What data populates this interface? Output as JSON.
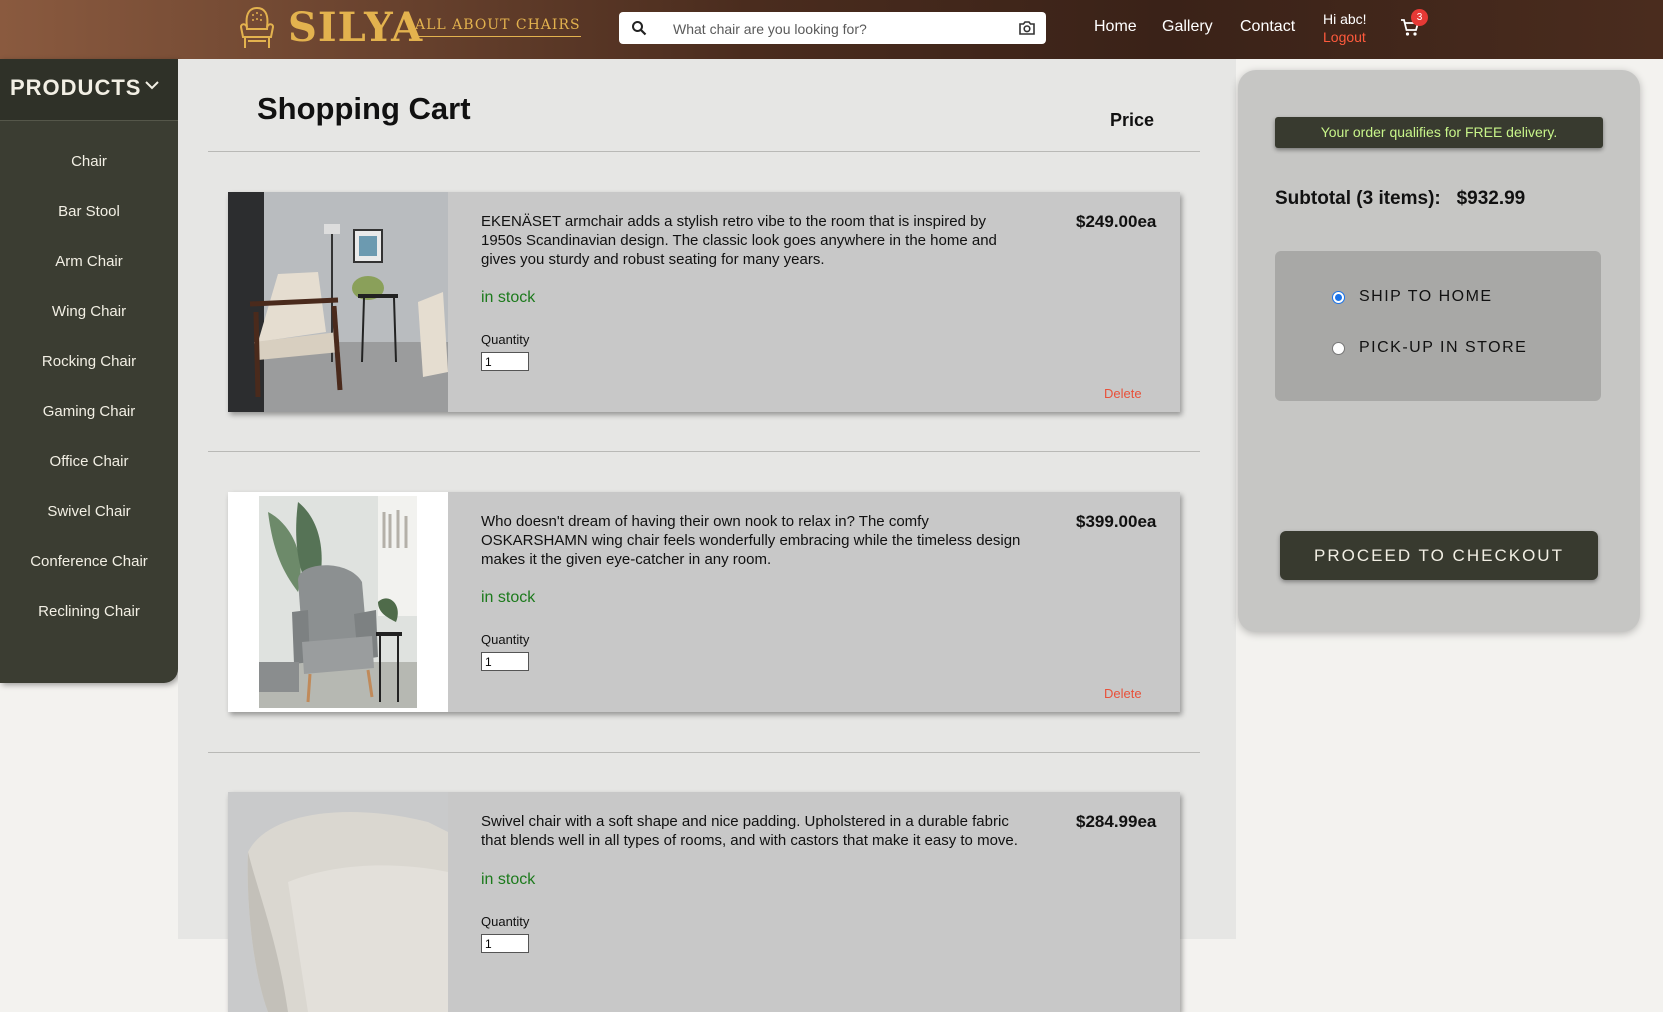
{
  "header": {
    "brand": "SILYA",
    "tagline": "ALL ABOUT CHAIRS",
    "search_placeholder": "What chair are you looking for?",
    "nav": [
      "Home",
      "Gallery",
      "Contact"
    ],
    "greeting": "Hi abc!",
    "logout": "Logout",
    "cart_count": "3",
    "accent_color": "#e3b24e"
  },
  "sidebar": {
    "title": "PRODUCTS",
    "items": [
      "Chair",
      "Bar Stool",
      "Arm Chair",
      "Wing Chair",
      "Rocking Chair",
      "Gaming Chair",
      "Office Chair",
      "Swivel Chair",
      "Conference Chair",
      "Reclining Chair"
    ]
  },
  "cart": {
    "title": "Shopping Cart",
    "price_header": "Price",
    "quantity_label": "Quantity",
    "delete_label": "Delete",
    "items": [
      {
        "description": "EKENÄSET armchair adds a stylish retro vibe to the room that is inspired by 1950s Scandinavian design. The classic look goes anywhere in the home and gives you sturdy and robust seating for many years.",
        "stock": "in stock",
        "quantity": "1",
        "price": "$249.00ea"
      },
      {
        "description": "Who doesn't dream of having their own nook to relax in? The comfy OSKARSHAMN wing chair feels wonderfully embracing while the timeless design makes it the given eye-catcher in any room.",
        "stock": "in stock",
        "quantity": "1",
        "price": "$399.00ea"
      },
      {
        "description": "Swivel chair with a soft shape and nice padding. Upholstered in a durable fabric that blends well in all types of rooms, and with castors that make it easy to move.",
        "stock": "in stock",
        "quantity": "1",
        "price": "$284.99ea"
      }
    ]
  },
  "summary": {
    "free_delivery": "Your order qualifies for FREE delivery.",
    "subtotal": "Subtotal (3 items):   $932.99",
    "ship_to_home": "SHIP TO HOME",
    "pickup": "PICK-UP IN STORE",
    "checkout": "PROCEED TO CHECKOUT"
  }
}
